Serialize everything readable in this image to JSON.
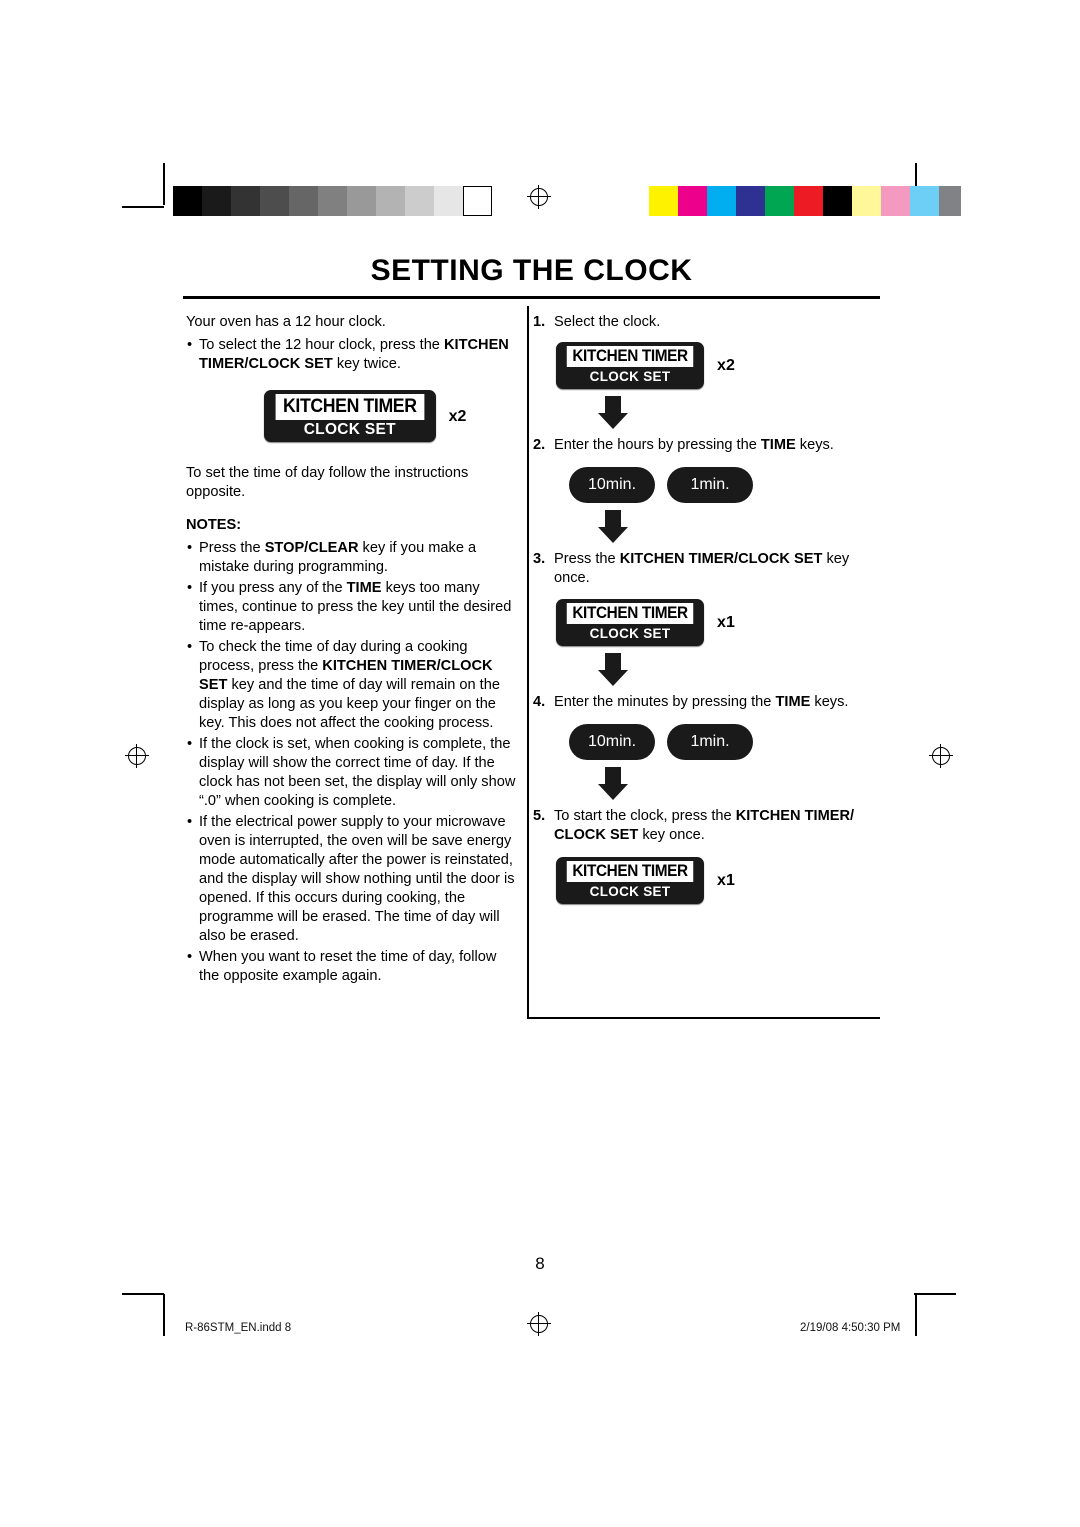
{
  "page": {
    "title": "SETTING THE CLOCK",
    "number": "8",
    "footer_left": "R-86STM_EN.indd   8",
    "footer_right": "2/19/08   4:50:30 PM"
  },
  "left": {
    "intro": "Your oven has a 12 hour clock.",
    "bullet1_a": "To select the 12 hour clock, press the ",
    "bullet1_b": "KITCHEN TIMER/CLOCK SET",
    "bullet1_c": " key twice.",
    "key1": {
      "line1": "KITCHEN TIMER",
      "line2": "CLOCK SET",
      "mult": "x2"
    },
    "para2": "To set the time of day follow the instructions opposite.",
    "notes_heading": "NOTES:",
    "notes": [
      {
        "a": "Press the ",
        "b": "STOP/CLEAR",
        "c": " key if you make a mistake during programming."
      },
      {
        "a": "If you press any of the ",
        "b": "TIME",
        "c": " keys too many times, continue to press the key until the desired time re-appears."
      },
      {
        "a": "To check the time of day during a cooking process, press the ",
        "b": "KITCHEN TIMER/CLOCK SET",
        "c": " key and the time of day will remain on the display as long as you keep your finger on the key. This does not affect the cooking process."
      },
      {
        "a": "If the clock is set, when cooking is complete, the display will show the correct time of day. If the clock has not been set, the display will only show “.0” when cooking is complete.",
        "b": "",
        "c": ""
      },
      {
        "a": "If the electrical power supply to your microwave oven is interrupted, the oven will be save energy mode automatically after the power is reinstated, and the display will show nothing until the door is opened. If this occurs during cooking, the programme will be erased. The time of day will also be erased.",
        "b": "",
        "c": ""
      },
      {
        "a": "When you want to reset the time of day, follow the opposite example again.",
        "b": "",
        "c": ""
      }
    ]
  },
  "right": {
    "steps": [
      {
        "num": "1.",
        "a": "Select the clock.",
        "b": "",
        "c": ""
      },
      {
        "num": "2.",
        "a": "Enter the hours by pressing the ",
        "b": "TIME",
        "c": " keys."
      },
      {
        "num": "3.",
        "a": "Press the ",
        "b": "KITCHEN TIMER/CLOCK SET",
        "c": " key once."
      },
      {
        "num": "4.",
        "a": "Enter the minutes by pressing the ",
        "b": "TIME",
        "c": " keys."
      },
      {
        "num": "5.",
        "a": "To start the clock, press the ",
        "b": "KITCHEN TIMER/ CLOCK SET",
        "c": " key once."
      }
    ],
    "key_step1": {
      "line1": "KITCHEN TIMER",
      "line2": "CLOCK SET",
      "mult": "x2"
    },
    "key_step3": {
      "line1": "KITCHEN TIMER",
      "line2": "CLOCK SET",
      "mult": "x1"
    },
    "key_step5": {
      "line1": "KITCHEN TIMER",
      "line2": "CLOCK SET",
      "mult": "x1"
    },
    "time_keys_hours": {
      "ten": "10min.",
      "one": "1min."
    },
    "time_keys_minutes": {
      "ten": "10min.",
      "one": "1min."
    }
  },
  "colorbars": {
    "grayscale": [
      "#000000",
      "#1a1a1a",
      "#333333",
      "#4d4d4d",
      "#666666",
      "#808080",
      "#999999",
      "#b3b3b3",
      "#cccccc",
      "#e6e6e6",
      "#ffffff"
    ],
    "process": [
      "#fff200",
      "#ec008c",
      "#00aeef",
      "#2e3192",
      "#00a651",
      "#ed1c24",
      "#000000",
      "#fff799",
      "#f49ac1",
      "#6dcff6",
      "#808285"
    ]
  }
}
